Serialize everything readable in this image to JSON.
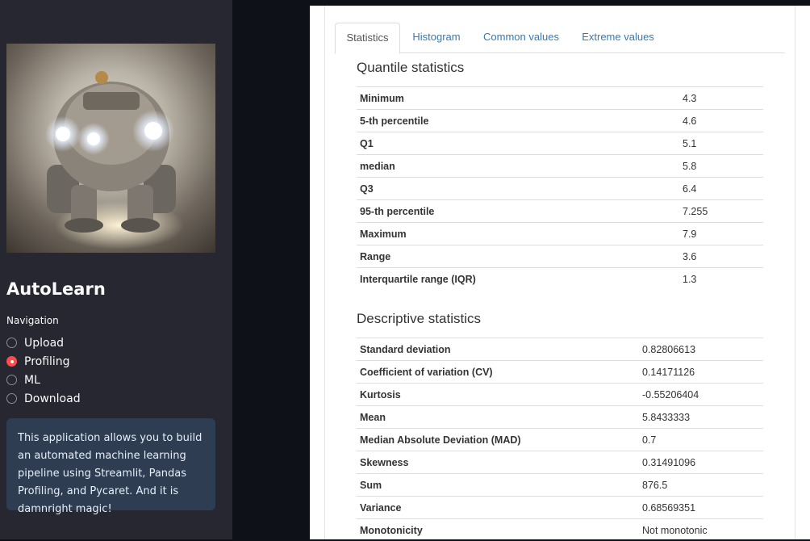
{
  "sidebar": {
    "hero_image": "robot-illustration",
    "app_title": "AutoLearn",
    "nav_label": "Navigation",
    "nav_options": [
      {
        "label": "Upload",
        "selected": false
      },
      {
        "label": "Profiling",
        "selected": true
      },
      {
        "label": "ML",
        "selected": false
      },
      {
        "label": "Download",
        "selected": false
      }
    ],
    "info_text": "This application allows you to build an automated machine learning pipeline using Streamlit, Pandas Profiling, and Pycaret. And it is damnright magic!",
    "accent_color": "#ff4b4b"
  },
  "report": {
    "tabs": [
      "Statistics",
      "Histogram",
      "Common values",
      "Extreme values"
    ],
    "active_tab": "Statistics",
    "quantile": {
      "title": "Quantile statistics",
      "rows": [
        [
          "Minimum",
          "4.3"
        ],
        [
          "5-th percentile",
          "4.6"
        ],
        [
          "Q1",
          "5.1"
        ],
        [
          "median",
          "5.8"
        ],
        [
          "Q3",
          "6.4"
        ],
        [
          "95-th percentile",
          "7.255"
        ],
        [
          "Maximum",
          "7.9"
        ],
        [
          "Range",
          "3.6"
        ],
        [
          "Interquartile range (IQR)",
          "1.3"
        ]
      ]
    },
    "descriptive": {
      "title": "Descriptive statistics",
      "rows": [
        [
          "Standard deviation",
          "0.82806613"
        ],
        [
          "Coefficient of variation (CV)",
          "0.14171126"
        ],
        [
          "Kurtosis",
          "-0.55206404"
        ],
        [
          "Mean",
          "5.8433333"
        ],
        [
          "Median Absolute Deviation (MAD)",
          "0.7"
        ],
        [
          "Skewness",
          "0.31491096"
        ],
        [
          "Sum",
          "876.5"
        ],
        [
          "Variance",
          "0.68569351"
        ],
        [
          "Monotonicity",
          "Not monotonic"
        ]
      ]
    },
    "link_color": "#337ab7"
  }
}
